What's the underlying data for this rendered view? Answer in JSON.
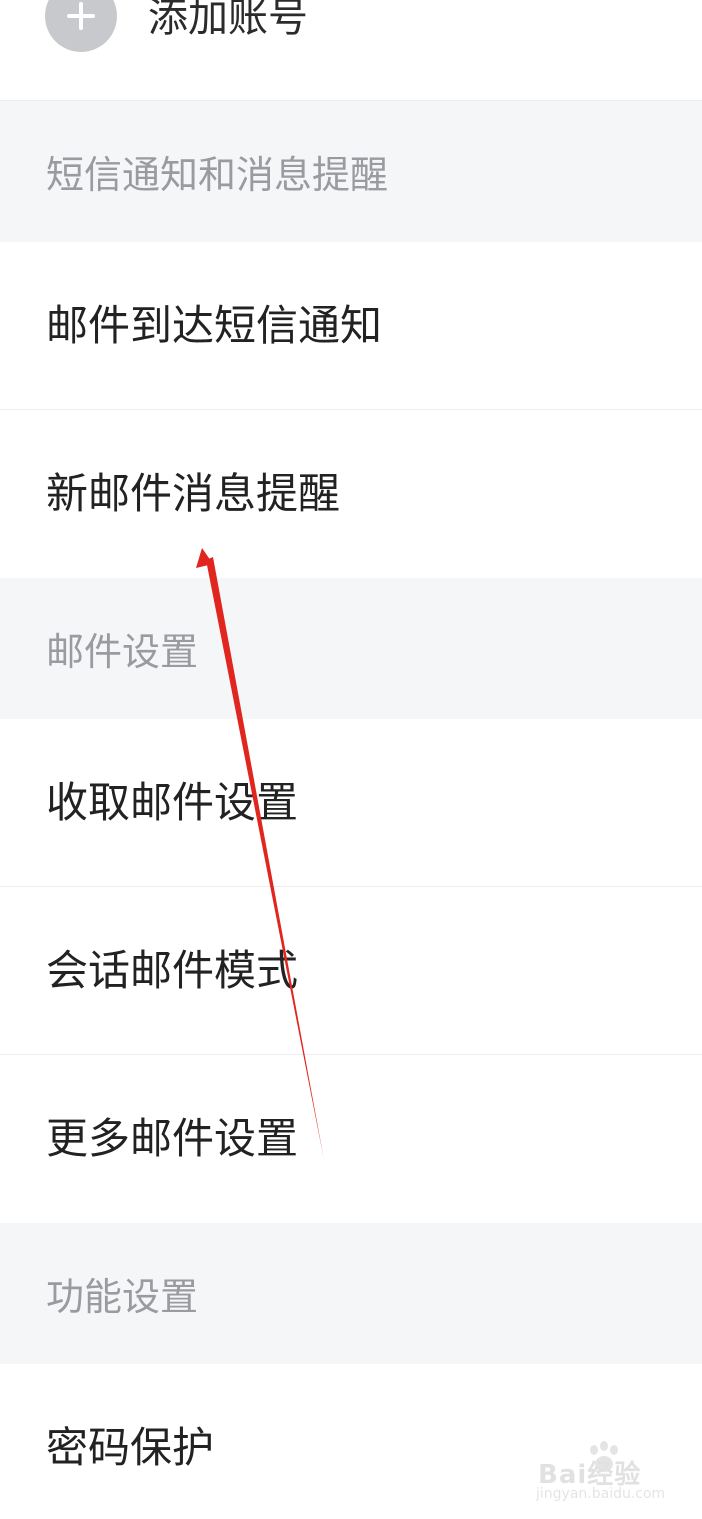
{
  "add_account": {
    "label": "添加账号",
    "icon": "plus-icon"
  },
  "sections": [
    {
      "header": "短信通知和消息提醒",
      "items": [
        "邮件到达短信通知",
        "新邮件消息提醒"
      ]
    },
    {
      "header": "邮件设置",
      "items": [
        "收取邮件设置",
        "会话邮件模式",
        "更多邮件设置"
      ]
    },
    {
      "header": "功能设置",
      "items": [
        "密码保护"
      ]
    }
  ],
  "annotation": {
    "type": "red-arrow",
    "color": "#e0261f",
    "points_to": "新邮件消息提醒"
  },
  "watermark": {
    "brand": "Bai经验",
    "url": "jingyan.baidu.com"
  },
  "colors": {
    "section_background": "#f5f6f8",
    "section_text": "#9a9ba0",
    "item_text": "#222222",
    "icon_gray": "#c8c9cc"
  }
}
